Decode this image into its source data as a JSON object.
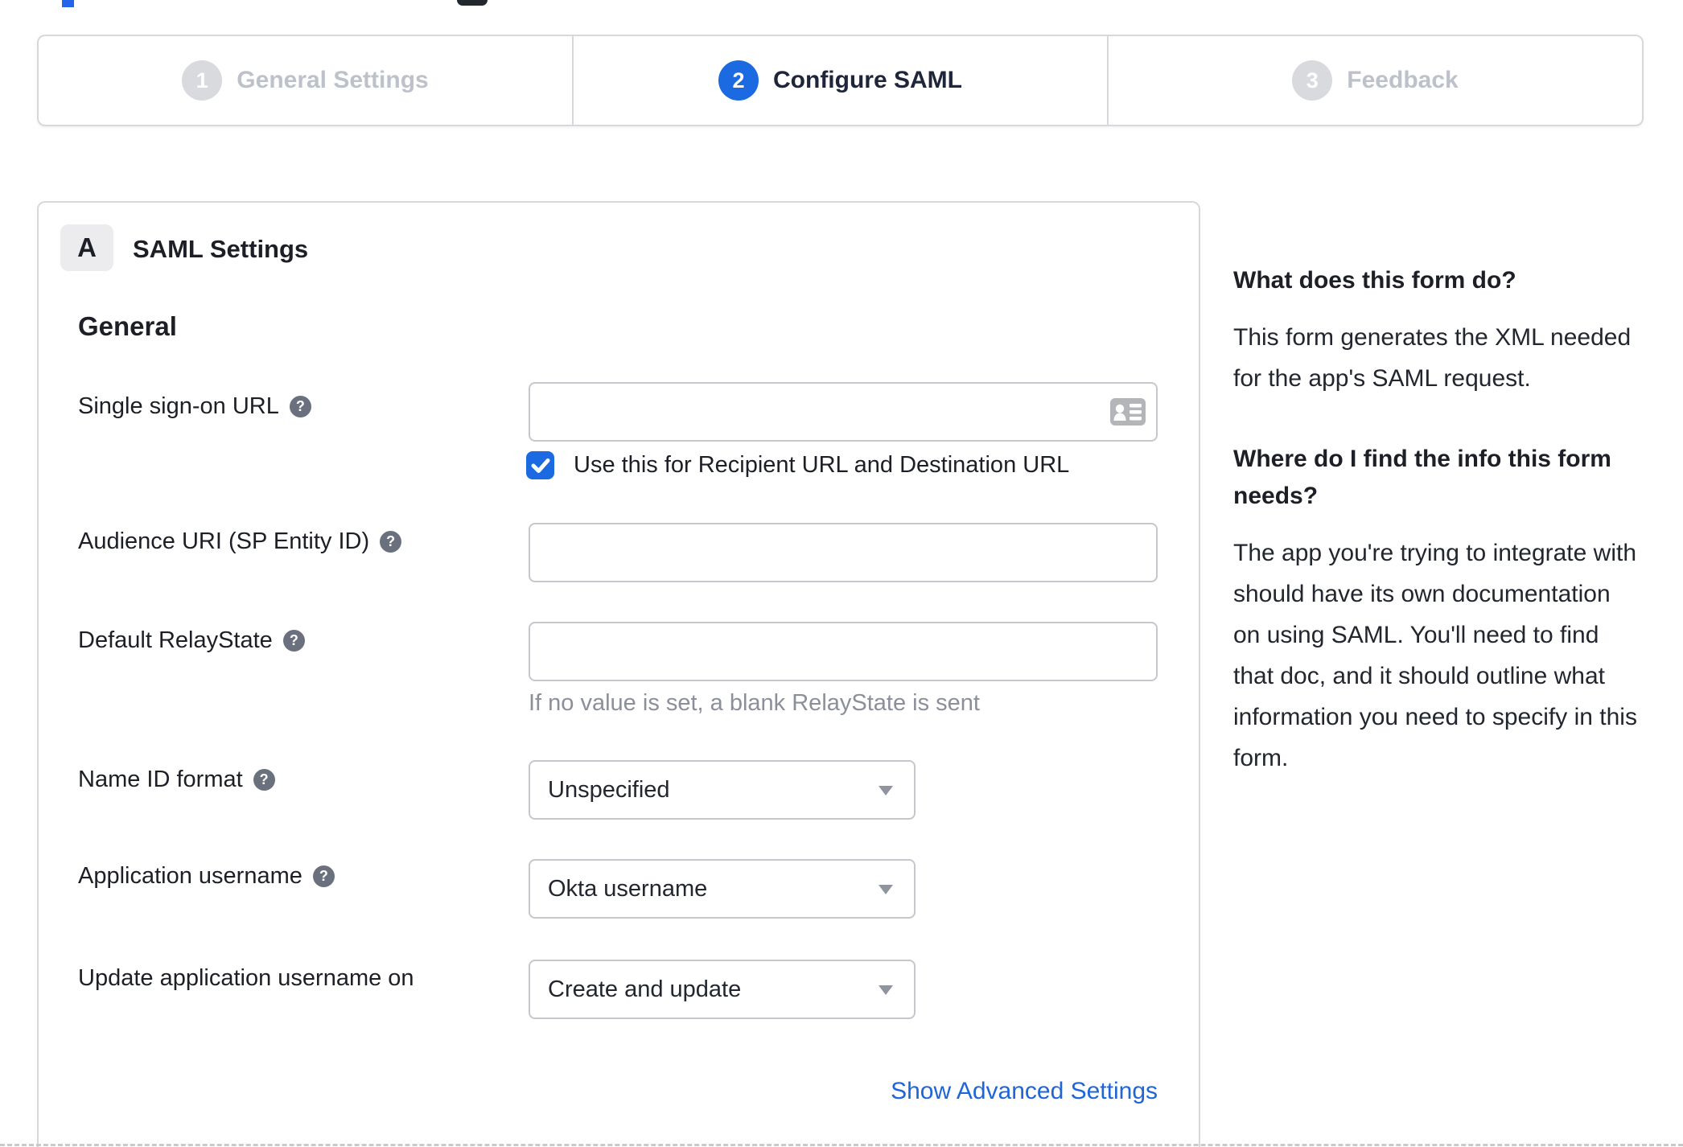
{
  "colors": {
    "accent_blue": "#1b6ae2",
    "link_blue": "#1e66d8",
    "inactive_gray": "#d8dade",
    "border_gray": "#d6d8dc",
    "hint_gray": "#8b8f9a"
  },
  "stepper": {
    "steps": [
      {
        "number": "1",
        "label": "General Settings",
        "state": "inactive"
      },
      {
        "number": "2",
        "label": "Configure SAML",
        "state": "active"
      },
      {
        "number": "3",
        "label": "Feedback",
        "state": "inactive"
      }
    ]
  },
  "panel": {
    "section_badge": "A",
    "section_title": "SAML Settings",
    "group_heading": "General",
    "fields": [
      {
        "label": "Single sign-on URL",
        "has_help": true,
        "type": "text",
        "value": "",
        "checkbox": {
          "checked": true,
          "label": "Use this for Recipient URL and Destination URL"
        }
      },
      {
        "label": "Audience URI (SP Entity ID)",
        "has_help": true,
        "type": "text",
        "value": ""
      },
      {
        "label": "Default RelayState",
        "has_help": true,
        "type": "text",
        "value": "",
        "hint": "If no value is set, a blank RelayState is sent"
      },
      {
        "label": "Name ID format",
        "has_help": true,
        "type": "select",
        "value": "Unspecified"
      },
      {
        "label": "Application username",
        "has_help": true,
        "type": "select",
        "value": "Okta username"
      },
      {
        "label": "Update application username on",
        "has_help": false,
        "type": "select",
        "value": "Create and update"
      }
    ],
    "advanced_link": "Show Advanced Settings"
  },
  "sidebar": {
    "sections": [
      {
        "heading": "What does this form do?",
        "body": "This form generates the XML needed for the app's SAML request."
      },
      {
        "heading": "Where do I find the info this form needs?",
        "body": "The app you're trying to integrate with should have its own documentation on using SAML. You'll need to find that doc, and it should outline what information you need to specify in this form."
      }
    ]
  }
}
